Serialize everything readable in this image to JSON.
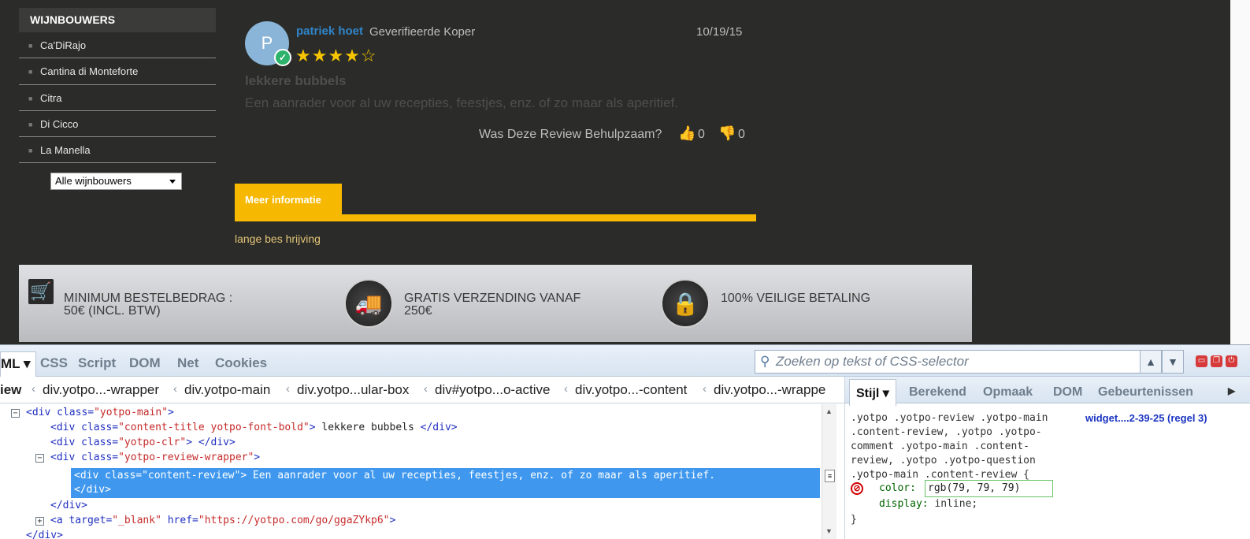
{
  "sidebar": {
    "heading": "WIJNBOUWERS",
    "items": [
      {
        "label": "Ca'DiRajo"
      },
      {
        "label": "Cantina di Monteforte"
      },
      {
        "label": "Citra"
      },
      {
        "label": "Di Cicco"
      },
      {
        "label": "La Manella"
      }
    ],
    "select_value": "Alle wijnbouwers"
  },
  "review": {
    "avatar_letter": "P",
    "reviewer_name": "patriek hoet",
    "buyer_label": "Geverifieerde Koper",
    "date": "10/19/15",
    "rating": 4,
    "rating_max": 5,
    "stars": "★★★★☆",
    "title": "lekkere bubbels",
    "body": "Een aanrader voor al uw recepties, feestjes, enz. of zo maar als aperitief.",
    "helpful_question": "Was Deze Review Behulpzaam?",
    "votes_up": "0",
    "votes_down": "0"
  },
  "more_info": {
    "tab_label": "Meer informatie",
    "text": "lange bes hrijving"
  },
  "features": [
    {
      "line1": "MINIMUM BESTELBEDRAG :",
      "line2": "50€ (INCL. BTW)",
      "icon": "cart-icon"
    },
    {
      "line1": "GRATIS VERZENDING VANAF",
      "line2": "250€",
      "icon": "truck-icon"
    },
    {
      "line1": "100% VEILIGE BETALING",
      "line2": "",
      "icon": "lock-icon"
    }
  ],
  "devtools": {
    "tabs": [
      "ML",
      "CSS",
      "Script",
      "DOM",
      "Net",
      "Cookies"
    ],
    "search_placeholder": "Zoeken op tekst of CSS-selector",
    "breadcrumbs": [
      "iew",
      "div.yotpo...-wrapper",
      "div.yotpo-main",
      "div.yotpo...ular-box",
      "div#yotpo...o-active",
      "div.yotpo...-content",
      "div.yotpo...-wrappe"
    ],
    "tree": {
      "line1": {
        "tag_open": "<div ",
        "attr": "class=",
        "val": "\"yotpo-main\"",
        "tag_close": ">"
      },
      "line2": {
        "tag_open": "<div ",
        "attr": "class=",
        "val": "\"content-title yotpo-font-bold\"",
        "tag_close": ">",
        "text": " lekkere bubbels ",
        "end": "</div>"
      },
      "line3": {
        "tag_open": "<div ",
        "attr": "class=",
        "val": "\"yotpo-clr\"",
        "tag_close": ">",
        "end": " </div>"
      },
      "line4": {
        "tag_open": "<div ",
        "attr": "class=",
        "val": "\"yotpo-review-wrapper\"",
        "tag_close": ">"
      },
      "selected_line1": "<div class=\"content-review\"> Een aanrader voor al uw recepties, feestjes, enz. of zo maar als aperitief.",
      "selected_line2": "</div>",
      "line6": "</div>",
      "line7": {
        "tag_open": "<a ",
        "attr1": "target=",
        "val1": "\"_blank\"",
        "attr2": " href=",
        "val2": "\"https://yotpo.com/go/ggaZYkp6\"",
        "tag_close": ">"
      },
      "line8": "</div>"
    },
    "side_tabs": [
      "Stijl",
      "Berekend",
      "Opmaak",
      "DOM",
      "Gebeurtenissen"
    ],
    "rule_selector": ".yotpo .yotpo-review .yotpo-main\n.content-review, .yotpo .yotpo-\ncomment .yotpo-main .content-\nreview, .yotpo .yotpo-question\n.yotpo-main .content-review {",
    "rule_source": "widget....2-39-25 (regel 3)",
    "prop1_name": "color:",
    "prop1_value": "rgb(79, 79, 79)",
    "prop2_name": "display:",
    "prop2_value": " inline;",
    "rule_close": "}"
  }
}
